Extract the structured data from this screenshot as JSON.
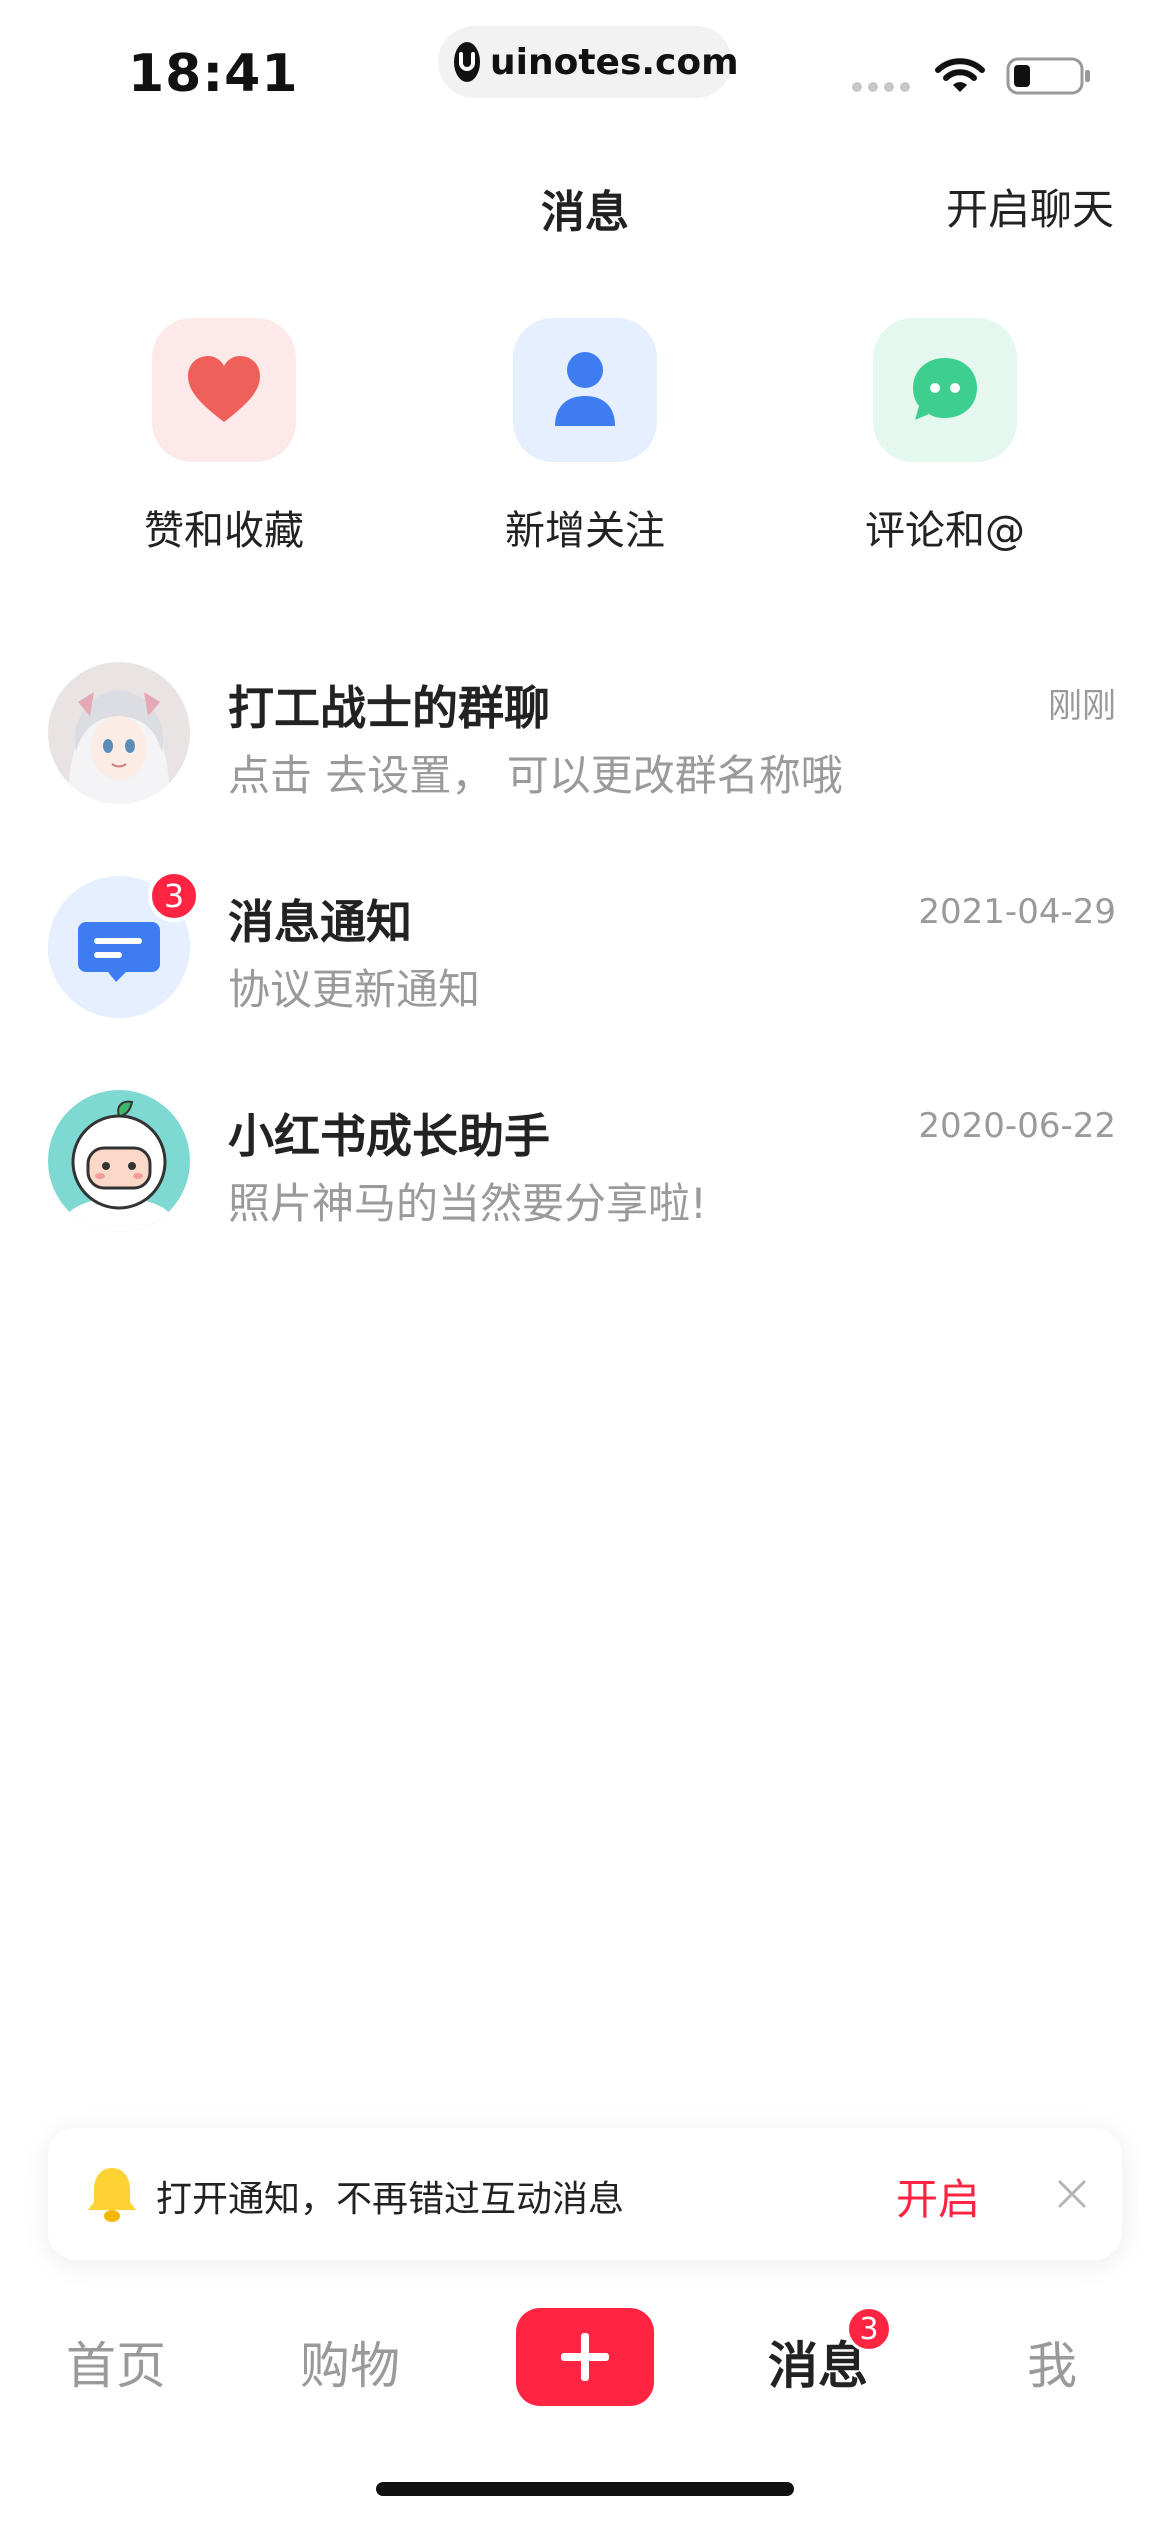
{
  "status_bar": {
    "time": "18:41",
    "url": "uinotes.com"
  },
  "header": {
    "title": "消息",
    "action": "开启聊天"
  },
  "categories": [
    {
      "label": "赞和收藏",
      "icon": "heart-icon",
      "color": "#f0605a",
      "bg": "#fde9e9"
    },
    {
      "label": "新增关注",
      "icon": "person-icon",
      "color": "#3e7cf2",
      "bg": "#e6efff"
    },
    {
      "label": "评论和@",
      "icon": "chat-icon",
      "color": "#3dcf8e",
      "bg": "#e4f8ef"
    }
  ],
  "conversations": [
    {
      "name": "打工战士的群聊",
      "message": "点击 去设置， 可以更改群名称哦",
      "time": "刚刚"
    },
    {
      "name": "消息通知",
      "message": "协议更新通知",
      "time": "2021-04-29",
      "badge": "3"
    },
    {
      "name": "小红书成长助手",
      "message": "照片神马的当然要分享啦!",
      "time": "2020-06-22"
    }
  ],
  "notify_banner": {
    "text": "打开通知，不再错过互动消息",
    "action": "开启"
  },
  "tabbar": {
    "home": "首页",
    "shop": "购物",
    "messages": "消息",
    "messages_badge": "3",
    "me": "我"
  },
  "colors": {
    "accent": "#ff2442"
  }
}
